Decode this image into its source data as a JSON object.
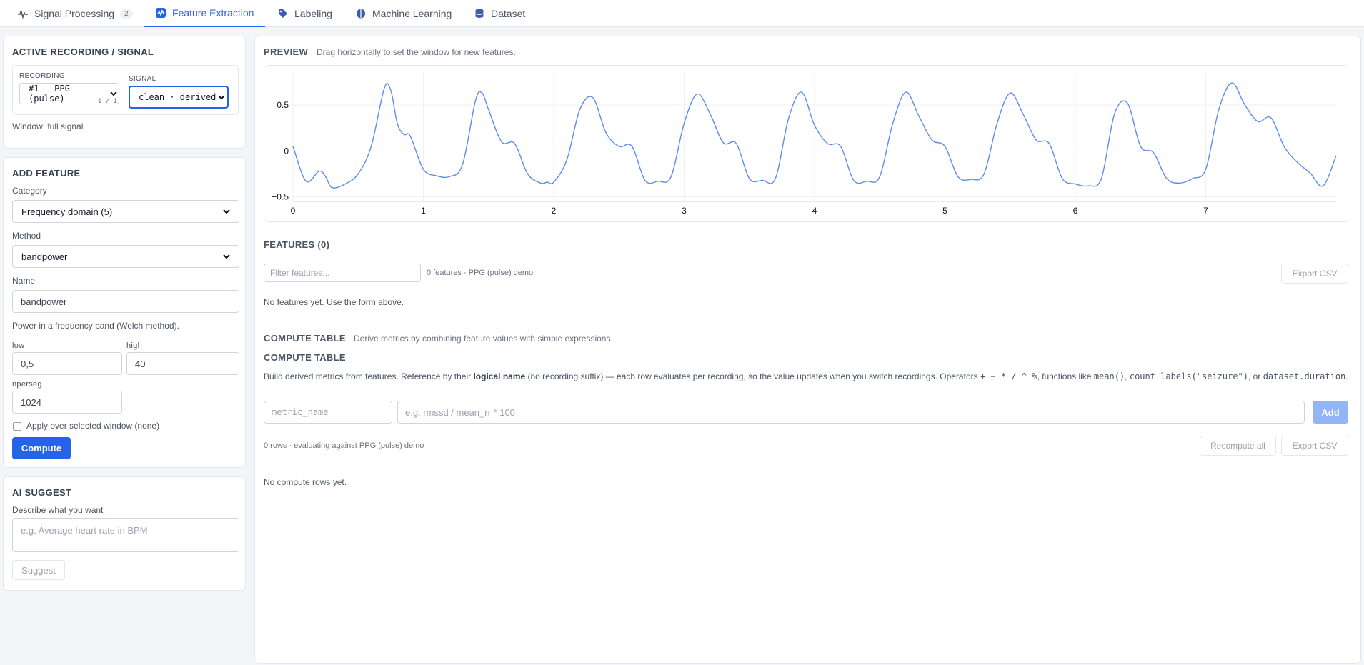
{
  "tabs": [
    {
      "label": "Signal Processing",
      "badge": "2"
    },
    {
      "label": "Feature Extraction"
    },
    {
      "label": "Labeling"
    },
    {
      "label": "Machine Learning"
    },
    {
      "label": "Dataset"
    }
  ],
  "active_recording": {
    "title": "ACTIVE RECORDING / SIGNAL",
    "recording_label": "RECORDING",
    "recording_value": "#1 — PPG (pulse)",
    "recording_counter": "1 / 1",
    "signal_label": "SIGNAL",
    "signal_value": "clean · derived",
    "window_text": "Window: full signal"
  },
  "add_feature": {
    "title": "ADD FEATURE",
    "category_label": "Category",
    "category_value": "Frequency domain (5)",
    "method_label": "Method",
    "method_value": "bandpower",
    "name_label": "Name",
    "name_value": "bandpower",
    "description": "Power in a frequency band (Welch method).",
    "low_label": "low",
    "low_value": "0,5",
    "high_label": "high",
    "high_value": "40",
    "nperseg_label": "nperseg",
    "nperseg_value": "1024",
    "apply_window_label": "Apply over selected window (none)",
    "compute_label": "Compute"
  },
  "ai_suggest": {
    "title": "AI SUGGEST",
    "describe_label": "Describe what you want",
    "placeholder": "e.g. Average heart rate in BPM",
    "suggest_label": "Suggest"
  },
  "preview": {
    "title": "PREVIEW",
    "hint": "Drag horizontally to set the window for new features."
  },
  "chart_data": {
    "type": "line",
    "title": "",
    "xlabel": "",
    "ylabel": "",
    "xlim": [
      0,
      8
    ],
    "ylim": [
      -0.55,
      0.85
    ],
    "x_ticks": [
      "0",
      "1",
      "2",
      "3",
      "4",
      "5",
      "6",
      "7"
    ],
    "y_ticks": [
      "0.5",
      "0",
      "−0.5"
    ],
    "grid": true,
    "series": [
      {
        "color": "#5b8def",
        "x": [
          0.0,
          0.1,
          0.2,
          0.25,
          0.3,
          0.4,
          0.5,
          0.6,
          0.7,
          0.75,
          0.8,
          0.85,
          0.9,
          1.0,
          1.1,
          1.2,
          1.3,
          1.4,
          1.45,
          1.5,
          1.6,
          1.7,
          1.8,
          1.9,
          1.95,
          2.0,
          2.1,
          2.2,
          2.3,
          2.4,
          2.5,
          2.6,
          2.7,
          2.8,
          2.9,
          3.0,
          3.1,
          3.2,
          3.3,
          3.4,
          3.5,
          3.6,
          3.7,
          3.8,
          3.9,
          4.0,
          4.1,
          4.2,
          4.3,
          4.4,
          4.5,
          4.6,
          4.7,
          4.8,
          4.9,
          5.0,
          5.1,
          5.2,
          5.3,
          5.4,
          5.5,
          5.6,
          5.7,
          5.8,
          5.9,
          6.0,
          6.1,
          6.2,
          6.3,
          6.4,
          6.5,
          6.6,
          6.7,
          6.8,
          6.9,
          7.0,
          7.1,
          7.2,
          7.3,
          7.4,
          7.5,
          7.6,
          7.7,
          7.8,
          7.9,
          8.0
        ],
        "y": [
          0.05,
          -0.33,
          -0.22,
          -0.28,
          -0.4,
          -0.36,
          -0.25,
          0.05,
          0.68,
          0.66,
          0.3,
          0.18,
          0.16,
          -0.2,
          -0.27,
          -0.28,
          -0.15,
          0.55,
          0.63,
          0.45,
          0.1,
          0.08,
          -0.25,
          -0.35,
          -0.34,
          -0.34,
          -0.1,
          0.45,
          0.58,
          0.2,
          0.05,
          0.05,
          -0.32,
          -0.33,
          -0.28,
          0.3,
          0.62,
          0.4,
          0.09,
          0.08,
          -0.3,
          -0.32,
          -0.3,
          0.35,
          0.64,
          0.28,
          0.08,
          0.05,
          -0.32,
          -0.33,
          -0.28,
          0.3,
          0.64,
          0.38,
          0.12,
          0.05,
          -0.28,
          -0.31,
          -0.25,
          0.3,
          0.63,
          0.4,
          0.12,
          0.08,
          -0.3,
          -0.36,
          -0.38,
          -0.3,
          0.4,
          0.52,
          0.05,
          -0.02,
          -0.3,
          -0.35,
          -0.3,
          -0.2,
          0.45,
          0.74,
          0.5,
          0.32,
          0.36,
          0.05,
          -0.12,
          -0.24,
          -0.38,
          -0.05
        ]
      }
    ]
  },
  "features": {
    "title": "FEATURES (0)",
    "filter_placeholder": "Filter features...",
    "count_text": "0 features · PPG (pulse) demo",
    "export_label": "Export CSV",
    "empty_text": "No features yet. Use the form above."
  },
  "compute": {
    "title": "COMPUTE TABLE",
    "subtitle": "Derive metrics by combining feature values with simple expressions.",
    "inner_title": "COMPUTE TABLE",
    "desc_1": "Build derived metrics from features. Reference by their ",
    "desc_bold": "logical name",
    "desc_2": " (no recording suffix) — each row evaluates per recording, so the value updates when you switch recordings. Operators ",
    "desc_ops": "+ − * / ^ %",
    "desc_3": ", functions like ",
    "desc_fn1": "mean()",
    "desc_4": ", ",
    "desc_fn2": "count_labels(\"seizure\")",
    "desc_5": ", or ",
    "desc_fn3": "dataset.duration",
    "desc_6": ".",
    "name_placeholder": "metric_name",
    "expr_placeholder": "e.g. rmssd / mean_rr * 100",
    "add_label": "Add",
    "rows_text": "0 rows · evaluating against PPG (pulse) demo",
    "recompute_label": "Recompute all",
    "export_label": "Export CSV",
    "empty_text": "No compute rows yet."
  },
  "colors": {
    "accent": "#2563eb",
    "line": "#5b8def"
  }
}
